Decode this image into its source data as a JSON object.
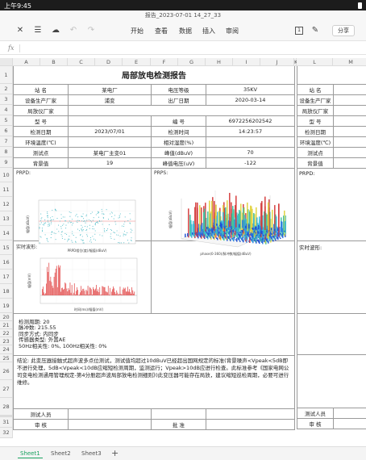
{
  "status": {
    "time": "上午9:45"
  },
  "window": {
    "title": "报告_2023-07-01 14_27_33"
  },
  "toolbar": {
    "menus": [
      "开始",
      "查看",
      "数据",
      "插入",
      "审阅"
    ],
    "sheet_count_badge": "1",
    "share_label": "分享"
  },
  "formula": {
    "fx": "fx"
  },
  "columns": [
    "A",
    "B",
    "C",
    "D",
    "E",
    "F",
    "G",
    "H",
    "I",
    "J",
    "K",
    "L",
    "M"
  ],
  "rows": [
    "1",
    "2",
    "3",
    "4",
    "5",
    "6",
    "7",
    "8",
    "9",
    "10",
    "11",
    "12",
    "13",
    "14",
    "15",
    "16",
    "17",
    "18",
    "19",
    "20",
    "21",
    "22",
    "23",
    "24",
    "25",
    "26",
    "27",
    "28",
    "29",
    "30",
    "31",
    "32"
  ],
  "report": {
    "title": "局部放电检测报告",
    "station_label": "站  名",
    "station_value": "某电厂",
    "voltage_label": "电压等级",
    "voltage_value": "35KV",
    "maker_label": "设备生产厂家",
    "maker_value": "浦变",
    "date_made_label": "出厂日期",
    "date_made_value": "2020-03-14",
    "instrument_label": "局放仪厂家",
    "model_label": "型  号",
    "serial_label": "编  号",
    "serial_value": "6972256202542",
    "test_date_label": "检测日期",
    "test_date_value": "2023/07/01",
    "test_time_label": "检测时间",
    "test_time_value": "14:23:57",
    "temp_label": "环境温度(℃)",
    "humidity_label": "相对湿度(%)",
    "point_label": "测试点",
    "point_value": "某电厂主变01",
    "peak_label": "峰值(dBuV)",
    "peak_value": "70",
    "bg_label": "背景值",
    "bg_value": "19",
    "peakv_label": "峰值电压(uV)",
    "peakv_value": "-122",
    "prpd_label": "PRPD:",
    "prps_label": "PRPS:",
    "realtime_label": "实时波形:",
    "stats": [
      "检测周期: 20",
      "脉冲数: 215.55",
      "同步方式: 内同步",
      "传感器类型: 外置AE",
      "50Hz相关性: 0%, 100Hz相关性: 0%"
    ],
    "conclusion": "结论: 此变压器接触式超声波多点位测试，测试值均超过10dBuV已经超出国网规定的标准(背景噪声<Vpeak<5dB即不进行处理，5dB<Vpeak<10dB应缩短检测周期，监测运行；Vpeak>10dB应进行检查。此标准参考《国家电网公司变电检测通用管理规定-第4分册超声波局部放电检测细则》)此变压器可能存在局放，建议缩短巡检周期，必要可进行维修。",
    "tester_label": "测试人员",
    "reviewer_label": "审  核",
    "approver_label": "批  准"
  },
  "right_panel": {
    "station_label": "站  名",
    "maker_label": "设备生产厂家",
    "instrument_label": "局放仪厂家",
    "model_label": "型  号",
    "test_date_label": "检测日期",
    "temp_label": "环境温度(℃)",
    "point_label": "测试点",
    "bg_label": "背景值",
    "prpd_label": "PRPD:",
    "realtime_label": "实时波形:",
    "tester_label": "测试人员",
    "reviewer_label": "审  核"
  },
  "charts": {
    "prpd_xlabel": "PRPD相位(度)/幅值(dBuV)",
    "prpd_ylabel": "幅值(dBuV)",
    "prps_xlabel": "phase(0-360)/脉冲数/幅值(dBuV)",
    "prps_ylabel": "幅值(dBuV)",
    "wave_xlabel": "时间(ms)/幅值(mV)",
    "wave_ylabel": "幅值(mV)"
  },
  "sheets": [
    "Sheet1",
    "Sheet2",
    "Sheet3"
  ],
  "active_sheet": "Sheet1",
  "colors": {
    "accent": "#1aa260",
    "prpd_dots": "#4fbcc8",
    "wave": "#e03a3a"
  }
}
